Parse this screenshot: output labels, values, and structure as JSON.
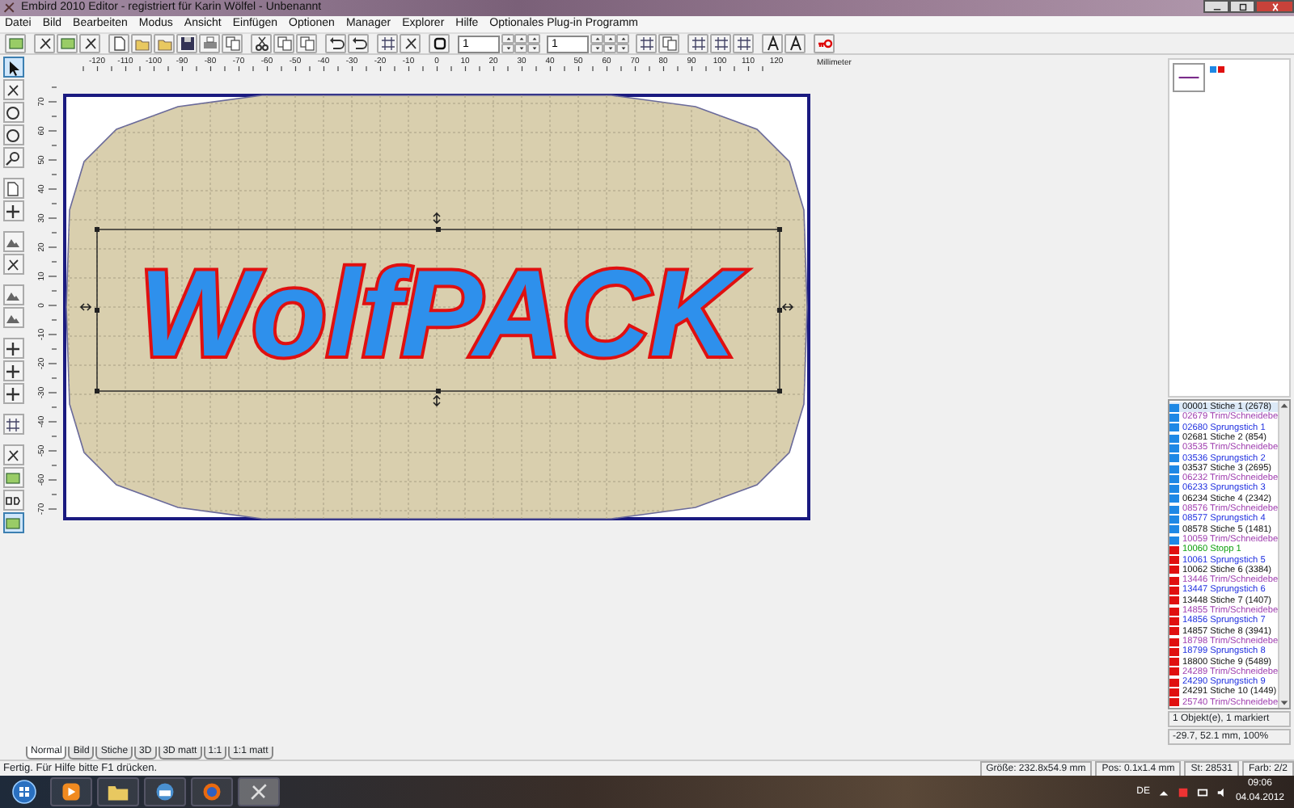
{
  "window": {
    "title": "Embird 2010 Editor - registriert für Karin Wölfel - Unbenannt"
  },
  "menu": [
    "Datei",
    "Bild",
    "Bearbeiten",
    "Modus",
    "Ansicht",
    "Einfügen",
    "Optionen",
    "Manager",
    "Explorer",
    "Hilfe",
    "Optionales Plug-in Programm"
  ],
  "toolbar": {
    "fields": [
      {
        "value": "1"
      },
      {
        "value": "1"
      }
    ]
  },
  "tools": [
    {
      "selected": true
    },
    {
      "selected": false
    },
    {
      "selected": false
    },
    {
      "selected": false
    },
    {
      "selected": false
    },
    {
      "selected": false
    },
    {
      "selected": false
    },
    {
      "selected": false
    },
    {
      "selected": false
    },
    {
      "selected": false
    },
    {
      "selected": false
    },
    {
      "selected": false
    },
    {
      "selected": false
    },
    {
      "selected": false
    },
    {
      "selected": false
    },
    {
      "selected": false
    },
    {
      "selected": false
    },
    {
      "selected": false
    },
    {
      "selected": true
    }
  ],
  "ruler": {
    "unit": "Millimeter",
    "horizontal_labels": [
      "-120",
      "-110",
      "-100",
      "-90",
      "-80",
      "-70",
      "-60",
      "-50",
      "-40",
      "-30",
      "-20",
      "-10",
      "0",
      "10",
      "20",
      "30",
      "40",
      "50",
      "60",
      "70",
      "80",
      "90",
      "100",
      "110",
      "120"
    ],
    "vertical_labels": [
      "70",
      "60",
      "50",
      "40",
      "30",
      "20",
      "10",
      "0",
      "-10",
      "-20",
      "-30",
      "-40",
      "-50",
      "-60",
      "-70"
    ]
  },
  "design": {
    "text": "WolfPACK"
  },
  "thumbnail_colors": [
    {
      "color": "#1e88e5"
    },
    {
      "color": "#e01010"
    }
  ],
  "color_list": {
    "rows": [
      {
        "number": "00001",
        "label": "Stiche 1 (2678)",
        "kind": "stitch",
        "color": "#1e88e5",
        "selected": true
      },
      {
        "number": "02679",
        "label": "Trim/Schneidebe",
        "kind": "trim",
        "color": "#1e88e5",
        "selected": false
      },
      {
        "number": "02680",
        "label": "Sprungstich 1",
        "kind": "jump",
        "color": "#1e88e5",
        "selected": false
      },
      {
        "number": "02681",
        "label": "Stiche 2 (854)",
        "kind": "stitch",
        "color": "#1e88e5",
        "selected": false
      },
      {
        "number": "03535",
        "label": "Trim/Schneidebe",
        "kind": "trim",
        "color": "#1e88e5",
        "selected": false
      },
      {
        "number": "03536",
        "label": "Sprungstich 2",
        "kind": "jump",
        "color": "#1e88e5",
        "selected": false
      },
      {
        "number": "03537",
        "label": "Stiche 3 (2695)",
        "kind": "stitch",
        "color": "#1e88e5",
        "selected": false
      },
      {
        "number": "06232",
        "label": "Trim/Schneidebe",
        "kind": "trim",
        "color": "#1e88e5",
        "selected": false
      },
      {
        "number": "06233",
        "label": "Sprungstich 3",
        "kind": "jump",
        "color": "#1e88e5",
        "selected": false
      },
      {
        "number": "06234",
        "label": "Stiche 4 (2342)",
        "kind": "stitch",
        "color": "#1e88e5",
        "selected": false
      },
      {
        "number": "08576",
        "label": "Trim/Schneidebe",
        "kind": "trim",
        "color": "#1e88e5",
        "selected": false
      },
      {
        "number": "08577",
        "label": "Sprungstich 4",
        "kind": "jump",
        "color": "#1e88e5",
        "selected": false
      },
      {
        "number": "08578",
        "label": "Stiche 5 (1481)",
        "kind": "stitch",
        "color": "#1e88e5",
        "selected": false
      },
      {
        "number": "10059",
        "label": "Trim/Schneidebe",
        "kind": "trim",
        "color": "#1e88e5",
        "selected": false
      },
      {
        "number": "10060",
        "label": "Stopp 1",
        "kind": "stop",
        "color": "#e01010",
        "selected": false
      },
      {
        "number": "10061",
        "label": "Sprungstich 5",
        "kind": "jump",
        "color": "#e01010",
        "selected": false
      },
      {
        "number": "10062",
        "label": "Stiche 6 (3384)",
        "kind": "stitch",
        "color": "#e01010",
        "selected": false
      },
      {
        "number": "13446",
        "label": "Trim/Schneidebe",
        "kind": "trim",
        "color": "#e01010",
        "selected": false
      },
      {
        "number": "13447",
        "label": "Sprungstich 6",
        "kind": "jump",
        "color": "#e01010",
        "selected": false
      },
      {
        "number": "13448",
        "label": "Stiche 7 (1407)",
        "kind": "stitch",
        "color": "#e01010",
        "selected": false
      },
      {
        "number": "14855",
        "label": "Trim/Schneidebe",
        "kind": "trim",
        "color": "#e01010",
        "selected": false
      },
      {
        "number": "14856",
        "label": "Sprungstich 7",
        "kind": "jump",
        "color": "#e01010",
        "selected": false
      },
      {
        "number": "14857",
        "label": "Stiche 8 (3941)",
        "kind": "stitch",
        "color": "#e01010",
        "selected": false
      },
      {
        "number": "18798",
        "label": "Trim/Schneidebe",
        "kind": "trim",
        "color": "#e01010",
        "selected": false
      },
      {
        "number": "18799",
        "label": "Sprungstich 8",
        "kind": "jump",
        "color": "#e01010",
        "selected": false
      },
      {
        "number": "18800",
        "label": "Stiche 9 (5489)",
        "kind": "stitch",
        "color": "#e01010",
        "selected": false
      },
      {
        "number": "24289",
        "label": "Trim/Schneidebe",
        "kind": "trim",
        "color": "#e01010",
        "selected": false
      },
      {
        "number": "24290",
        "label": "Sprungstich 9",
        "kind": "jump",
        "color": "#e01010",
        "selected": false
      },
      {
        "number": "24291",
        "label": "Stiche 10 (1449)",
        "kind": "stitch",
        "color": "#e01010",
        "selected": false
      },
      {
        "number": "25740",
        "label": "Trim/Schneidebe",
        "kind": "trim",
        "color": "#e01010",
        "selected": false
      }
    ]
  },
  "panel_info": [
    "1 Objekt(e), 1 markiert",
    "-29.7, 52.1 mm, 100%"
  ],
  "view_tabs": [
    {
      "label": "Normal",
      "selected": true
    },
    {
      "label": "Bild",
      "selected": false
    },
    {
      "label": "Stiche",
      "selected": false
    },
    {
      "label": "3D",
      "selected": false
    },
    {
      "label": "3D matt",
      "selected": false
    },
    {
      "label": "1:1",
      "selected": false
    },
    {
      "label": "1:1 matt",
      "selected": false
    }
  ],
  "status_bar": {
    "message": "Fertig. Für Hilfe bitte F1 drücken.",
    "fields": [
      "Größe: 232.8x54.9 mm",
      "Pos: 0.1x1.4 mm",
      "St: 28531",
      "Farb: 2/2"
    ]
  },
  "taskbar": {
    "language": "DE",
    "time": "09:06",
    "date": "04.04.2012"
  }
}
